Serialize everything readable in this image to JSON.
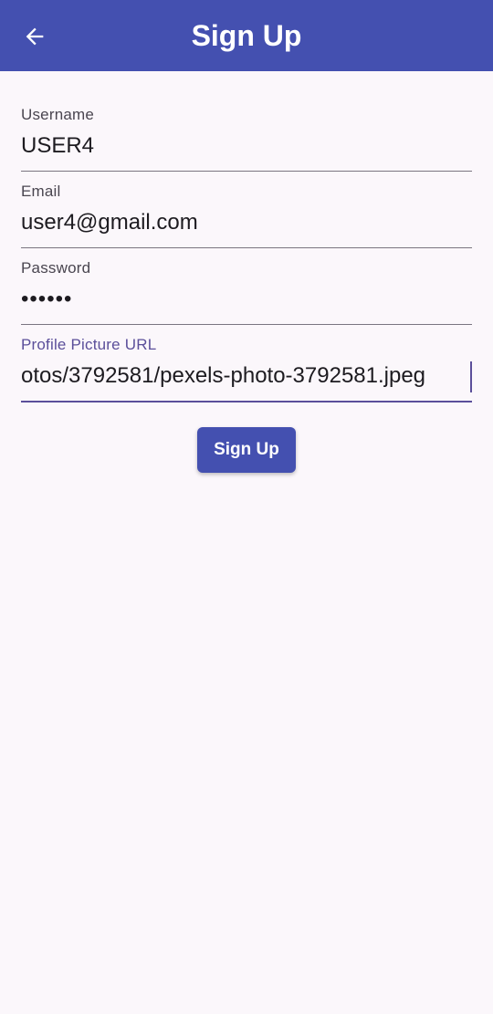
{
  "app_bar": {
    "title": "Sign Up",
    "back_icon": "arrow-back-icon",
    "background": "#4450b0"
  },
  "form": {
    "username": {
      "label": "Username",
      "value": "USER4"
    },
    "email": {
      "label": "Email",
      "value": "user4@gmail.com"
    },
    "password": {
      "label": "Password",
      "value": "••••••"
    },
    "profile_picture_url": {
      "label": "Profile Picture URL",
      "value": "otos/3792581/pexels-photo-3792581.jpeg"
    }
  },
  "submit_button": {
    "label": "Sign Up"
  },
  "colors": {
    "accent": "#4450b0",
    "focus": "#5b4f9a",
    "background": "#fbf7fb"
  }
}
